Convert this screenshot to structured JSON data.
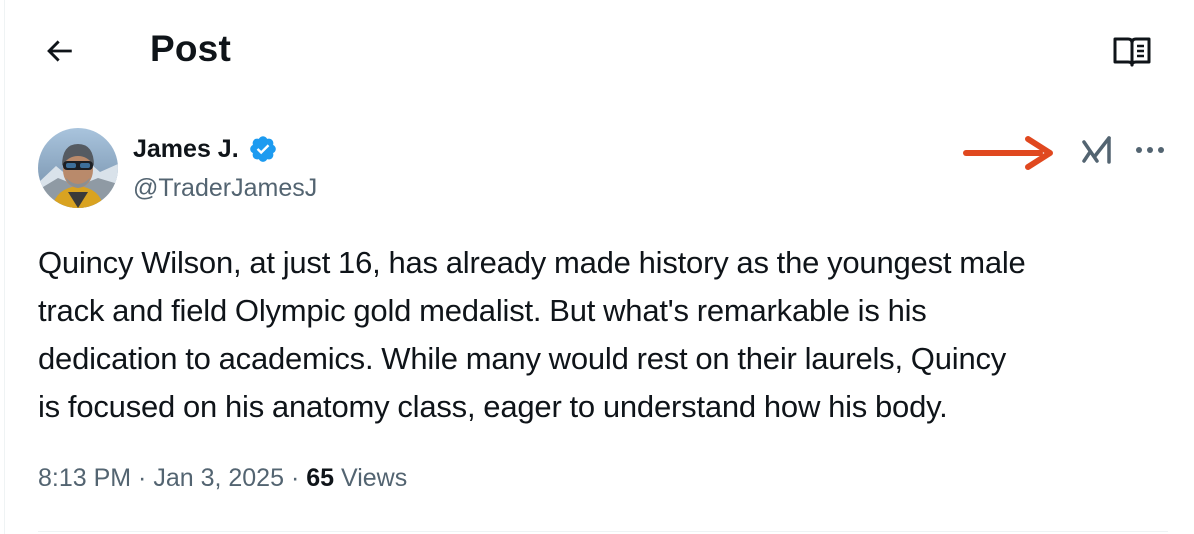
{
  "header": {
    "title": "Post",
    "back_icon": "arrow-left-icon",
    "reader_icon": "reader-mode-icon"
  },
  "author": {
    "name": "James J.",
    "handle": "@TraderJamesJ",
    "verified": true,
    "badge_color": "#1d9bf0"
  },
  "actions": {
    "grok_icon": "grok-icon",
    "more_icon": "more-options-icon",
    "annotation_arrow_color": "#e0481f"
  },
  "post": {
    "text_lines": [
      "Quincy Wilson, at just 16, has already made history as the youngest male",
      "track and field Olympic gold medalist. But what's remarkable is his",
      "dedication to academics. While many would rest on their laurels, Quincy",
      "is focused on his anatomy class, eager to understand how his body."
    ]
  },
  "meta": {
    "time": "8:13 PM",
    "separator": " · ",
    "date": "Jan 3, 2025",
    "views_count": "65",
    "views_label": " Views"
  },
  "colors": {
    "text_primary": "#0f1419",
    "text_secondary": "#536471",
    "divider": "#eff3f4"
  }
}
